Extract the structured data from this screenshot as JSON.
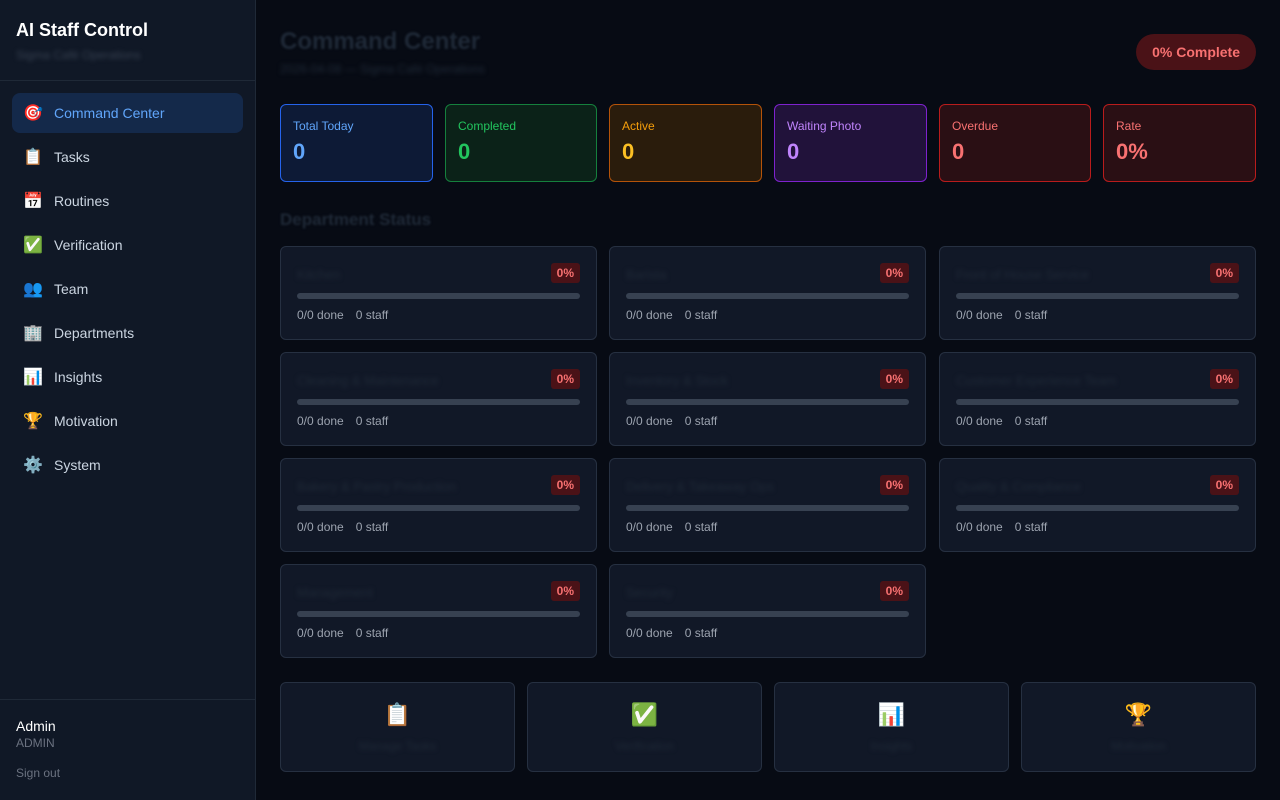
{
  "sidebar": {
    "title": "AI Staff Control",
    "subtitle": "Sigma Café Operations",
    "items": [
      {
        "label": "Command Center",
        "icon": "🎯",
        "name": "target-icon"
      },
      {
        "label": "Tasks",
        "icon": "📋",
        "name": "clipboard-icon"
      },
      {
        "label": "Routines",
        "icon": "📅",
        "name": "calendar-icon"
      },
      {
        "label": "Verification",
        "icon": "✅",
        "name": "check-icon"
      },
      {
        "label": "Team",
        "icon": "👥",
        "name": "team-icon"
      },
      {
        "label": "Departments",
        "icon": "🏢",
        "name": "building-icon"
      },
      {
        "label": "Insights",
        "icon": "📊",
        "name": "chart-icon"
      },
      {
        "label": "Motivation",
        "icon": "🏆",
        "name": "trophy-icon"
      },
      {
        "label": "System",
        "icon": "⚙️",
        "name": "gear-icon"
      }
    ],
    "active_index": 0,
    "user": {
      "name": "Admin",
      "role": "ADMIN"
    },
    "signout_label": "Sign out"
  },
  "header": {
    "title": "Command Center",
    "subtitle": "2026-04-08 — Sigma Café Operations",
    "complete_label": "0% Complete"
  },
  "stats": [
    {
      "label": "Total Today",
      "value": "0",
      "variant": "blue"
    },
    {
      "label": "Completed",
      "value": "0",
      "variant": "green"
    },
    {
      "label": "Active",
      "value": "0",
      "variant": "orange"
    },
    {
      "label": "Waiting Photo",
      "value": "0",
      "variant": "purple"
    },
    {
      "label": "Overdue",
      "value": "0",
      "variant": "red"
    },
    {
      "label": "Rate",
      "value": "0%",
      "variant": "red"
    }
  ],
  "departments_title": "Department Status",
  "departments": [
    {
      "name": "Kitchen",
      "percent_label": "0%",
      "progress": 0,
      "done_label": "0/0 done",
      "staff_label": "0 staff"
    },
    {
      "name": "Barista",
      "percent_label": "0%",
      "progress": 0,
      "done_label": "0/0 done",
      "staff_label": "0 staff"
    },
    {
      "name": "Front of House Service",
      "percent_label": "0%",
      "progress": 0,
      "done_label": "0/0 done",
      "staff_label": "0 staff"
    },
    {
      "name": "Cleaning & Maintenance",
      "percent_label": "0%",
      "progress": 0,
      "done_label": "0/0 done",
      "staff_label": "0 staff"
    },
    {
      "name": "Inventory & Stock",
      "percent_label": "0%",
      "progress": 0,
      "done_label": "0/0 done",
      "staff_label": "0 staff"
    },
    {
      "name": "Customer Experience Team",
      "percent_label": "0%",
      "progress": 0,
      "done_label": "0/0 done",
      "staff_label": "0 staff"
    },
    {
      "name": "Bakery & Pastry Production",
      "percent_label": "0%",
      "progress": 0,
      "done_label": "0/0 done",
      "staff_label": "0 staff"
    },
    {
      "name": "Delivery & Takeaway Ops",
      "percent_label": "0%",
      "progress": 0,
      "done_label": "0/0 done",
      "staff_label": "0 staff"
    },
    {
      "name": "Quality & Compliance",
      "percent_label": "0%",
      "progress": 0,
      "done_label": "0/0 done",
      "staff_label": "0 staff"
    },
    {
      "name": "Management",
      "percent_label": "0%",
      "progress": 0,
      "done_label": "0/0 done",
      "staff_label": "0 staff"
    },
    {
      "name": "Security",
      "percent_label": "0%",
      "progress": 0,
      "done_label": "0/0 done",
      "staff_label": "0 staff"
    }
  ],
  "quick_actions": [
    {
      "label": "Manage Tasks",
      "icon": "📋",
      "name": "clipboard-icon"
    },
    {
      "label": "Verification",
      "icon": "✅",
      "name": "check-icon"
    },
    {
      "label": "Insights",
      "icon": "📊",
      "name": "chart-icon"
    },
    {
      "label": "Motivation",
      "icon": "🏆",
      "name": "trophy-icon"
    }
  ]
}
